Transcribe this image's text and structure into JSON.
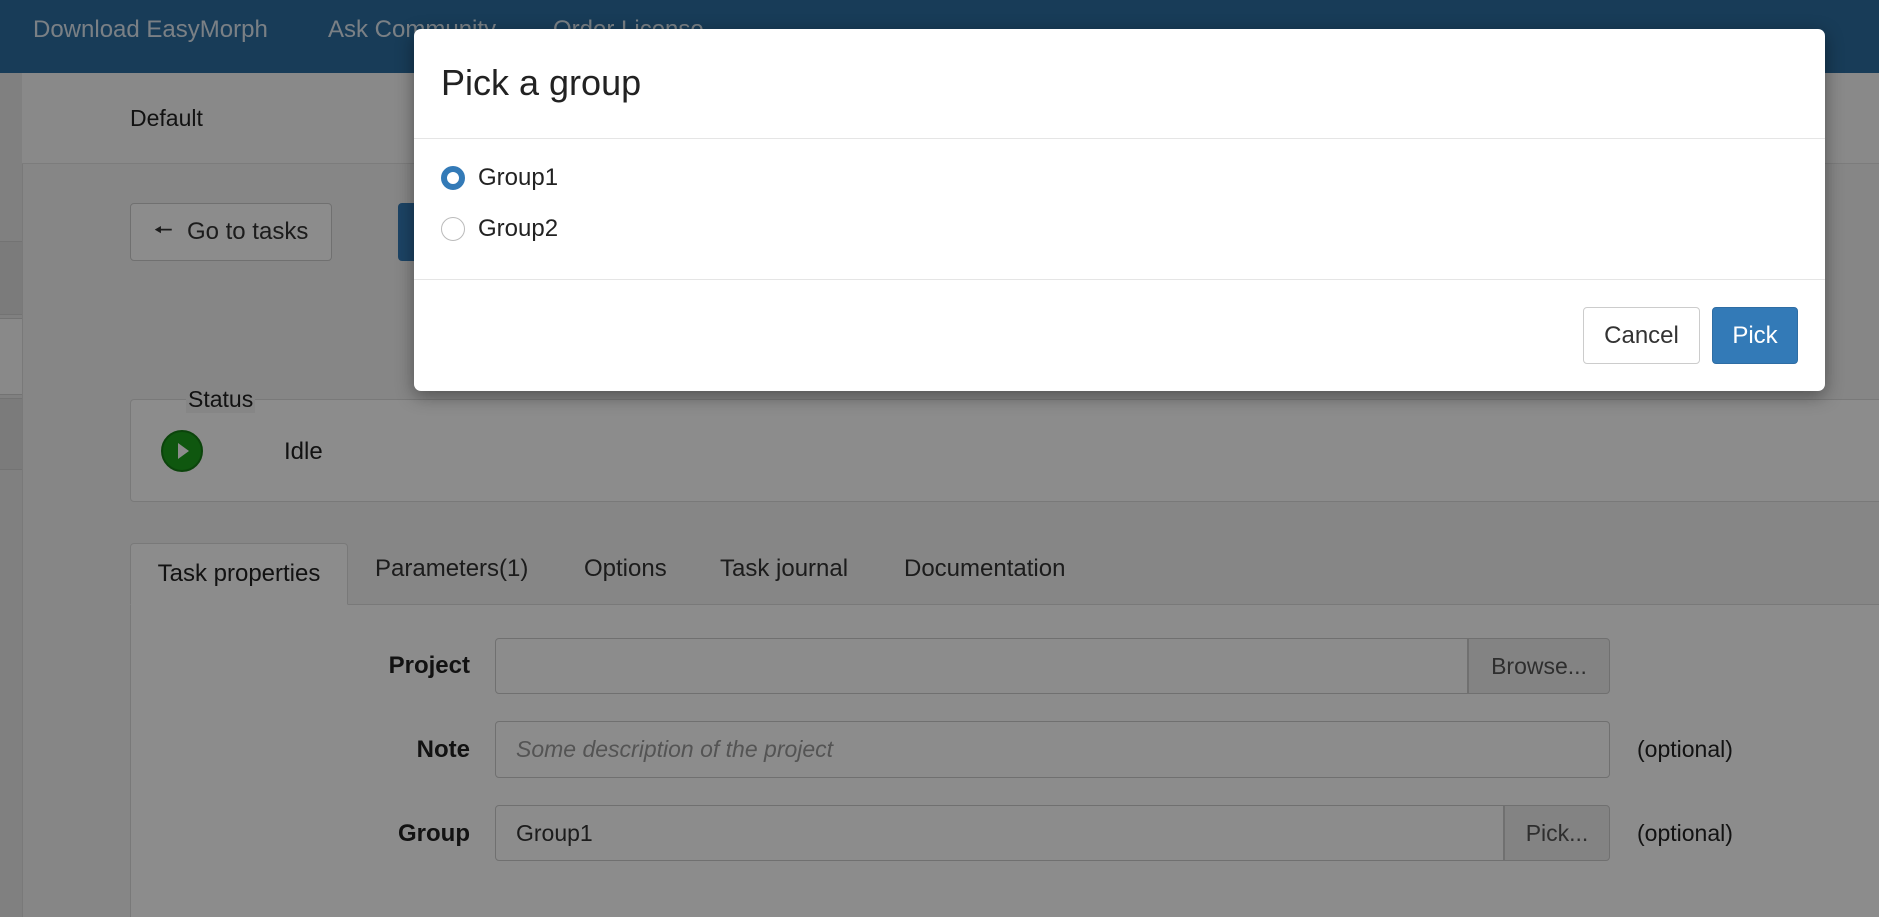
{
  "topnav": {
    "links": [
      "Download EasyMorph",
      "Ask Community",
      "Order License"
    ]
  },
  "breadcrumb": {
    "current": "Default"
  },
  "toolbar": {
    "go_to_tasks_label": "Go to tasks",
    "go_to_tasks_icon": "arrow-left-icon"
  },
  "status": {
    "legend": "Status",
    "value": "Idle",
    "icon": "play-circle-icon",
    "icon_color": "#1c9e1c"
  },
  "tabs": [
    {
      "label": "Task properties",
      "active": true
    },
    {
      "label": "Parameters(1)",
      "active": false
    },
    {
      "label": "Options",
      "active": false
    },
    {
      "label": "Task journal",
      "active": false
    },
    {
      "label": "Documentation",
      "active": false
    }
  ],
  "form": {
    "project": {
      "label": "Project",
      "value": "",
      "button": "Browse..."
    },
    "note": {
      "label": "Note",
      "value": "",
      "placeholder": "Some description of the project",
      "hint": "(optional)"
    },
    "group": {
      "label": "Group",
      "value": "Group1",
      "button": "Pick...",
      "hint": "(optional)"
    }
  },
  "modal": {
    "title": "Pick a group",
    "options": [
      {
        "label": "Group1",
        "checked": true
      },
      {
        "label": "Group2",
        "checked": false
      }
    ],
    "cancel_label": "Cancel",
    "pick_label": "Pick",
    "accent_color": "#337ab7"
  }
}
